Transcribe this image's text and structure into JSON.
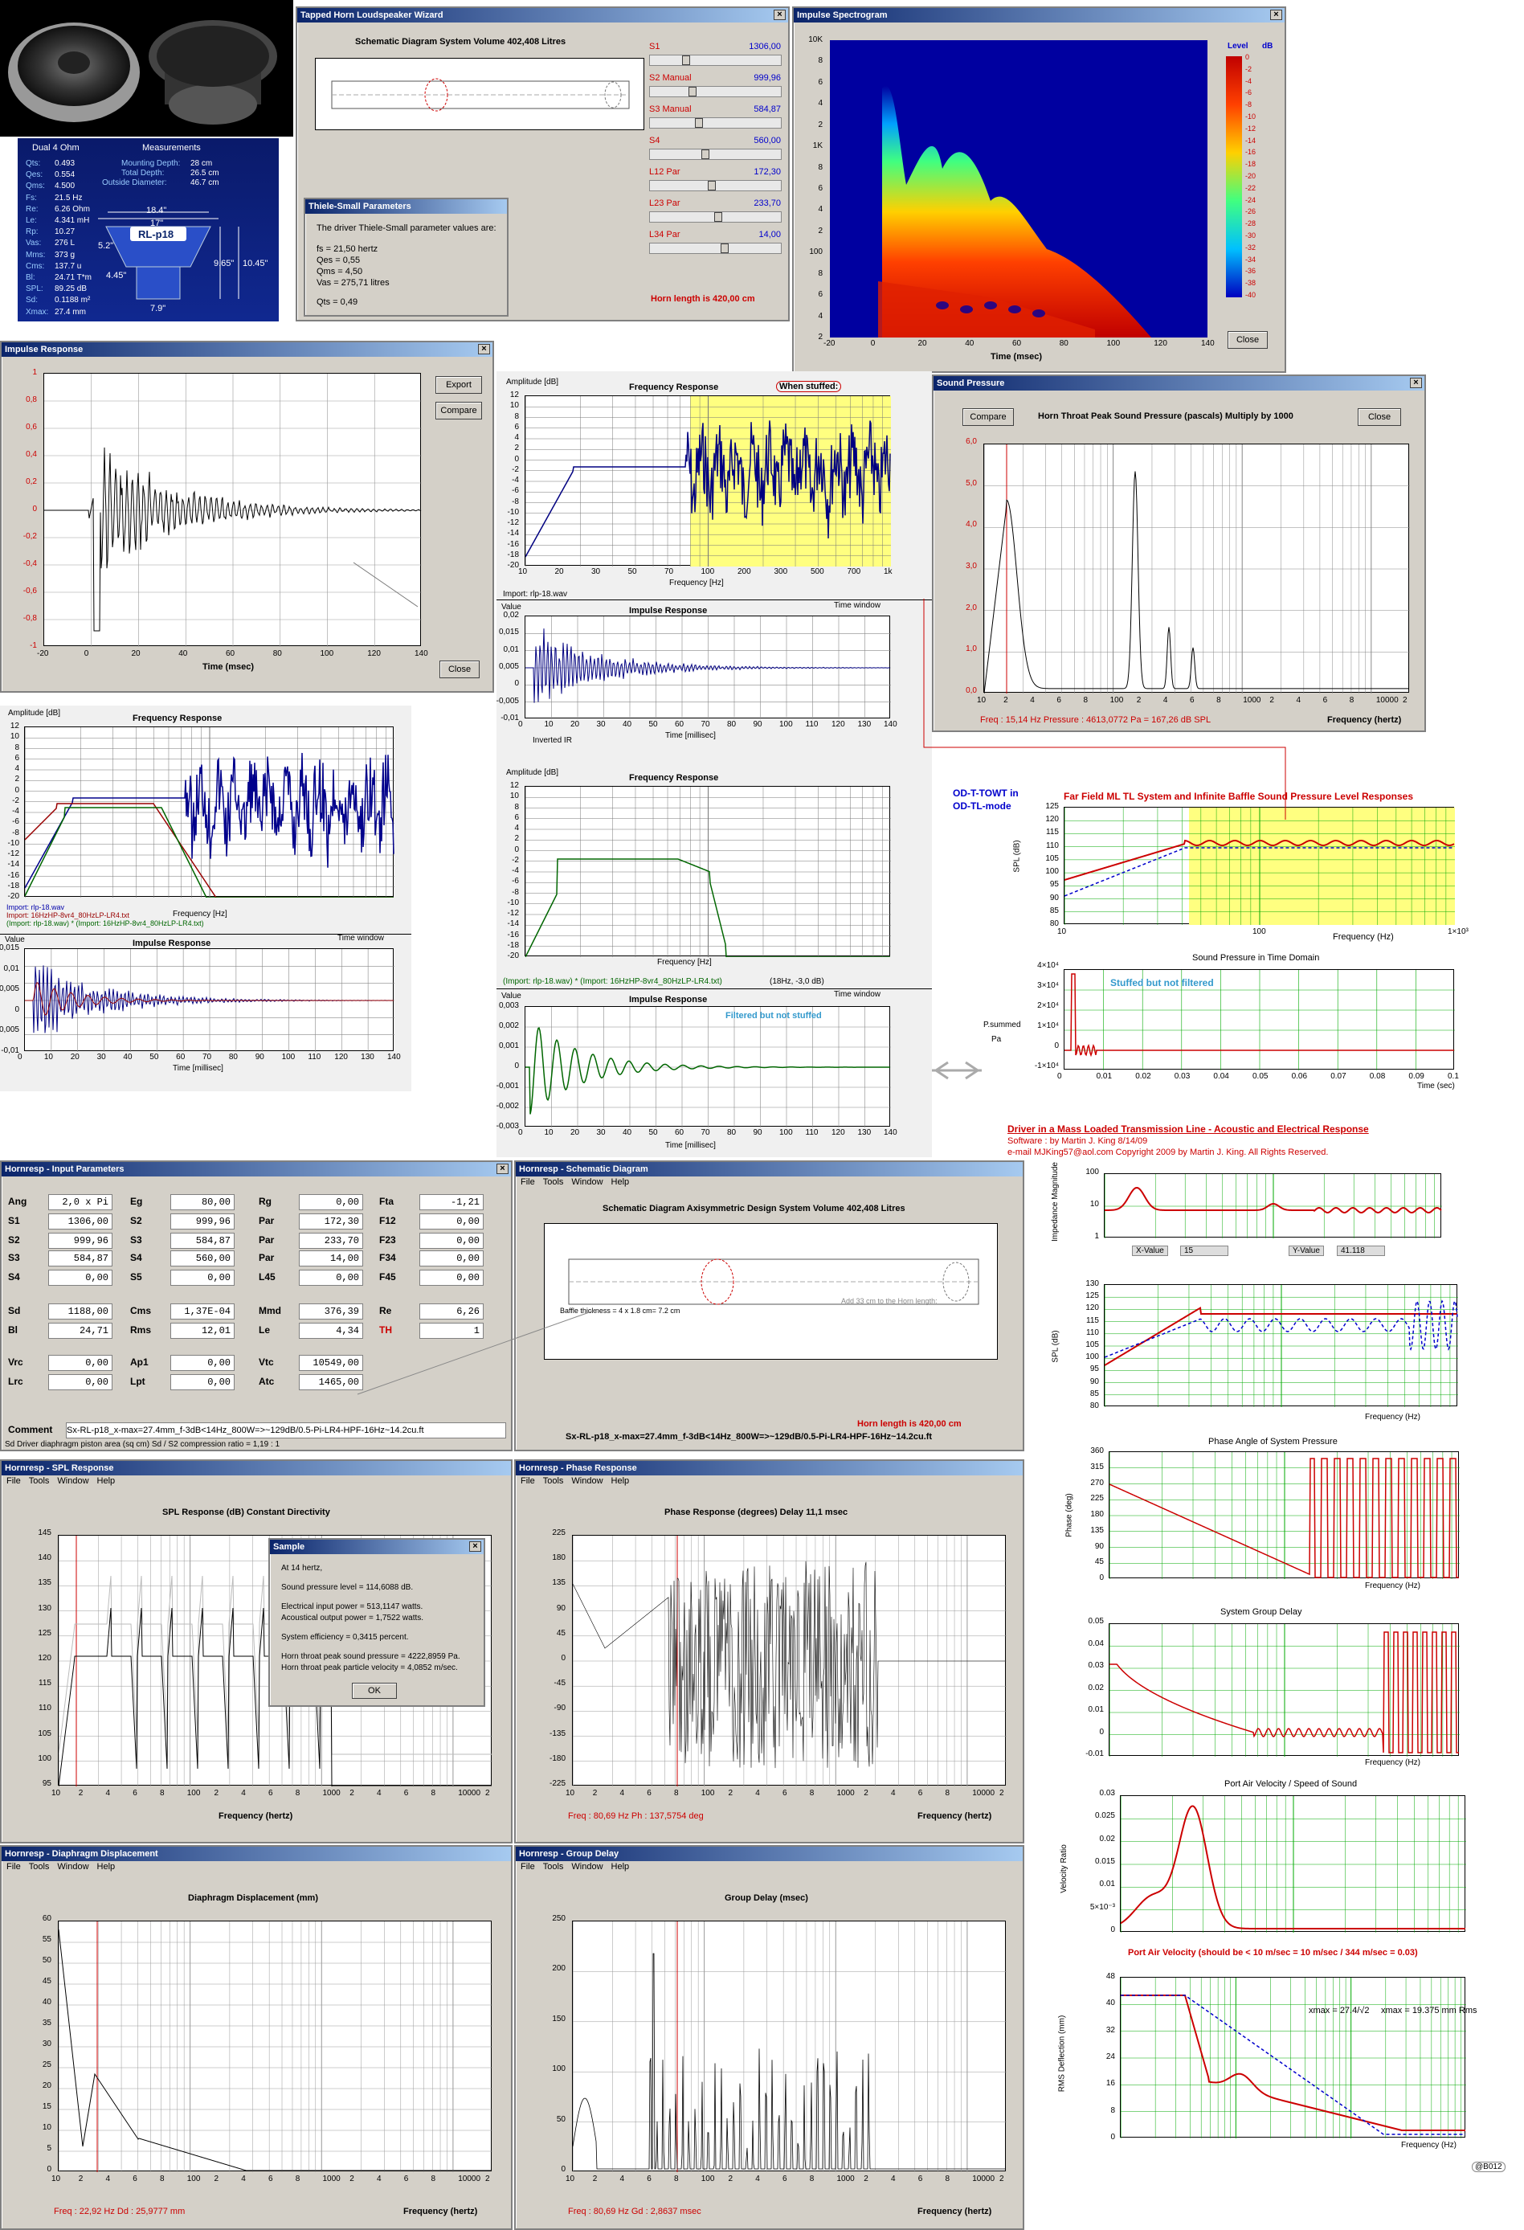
{
  "photo": {
    "panel_labels": {
      "left": "Dual 4 Ohm",
      "right": "Measurements"
    },
    "params": [
      [
        "Qts:",
        "0.493"
      ],
      [
        "Qes:",
        "0.554"
      ],
      [
        "Qms:",
        "4.500"
      ],
      [
        "Fs:",
        "21.5 Hz"
      ],
      [
        "Re:",
        "6.26 Ohm"
      ],
      [
        "Le:",
        "4.341 mH"
      ],
      [
        "Rp:",
        "10.27"
      ],
      [
        "Vas:",
        "276 L"
      ],
      [
        "Mms:",
        "373 g"
      ],
      [
        "Cms:",
        "137.7 u"
      ],
      [
        "Bl:",
        "24.71 T*m"
      ],
      [
        "SPL:",
        "89.25 dB"
      ],
      [
        "Sd:",
        "0.1188 m²"
      ],
      [
        "Xmax:",
        "27.4 mm"
      ]
    ],
    "measures": [
      [
        "Mounting Depth:",
        "28 cm"
      ],
      [
        "Total Depth:",
        "26.5 cm"
      ],
      [
        "Outside Diameter:",
        "46.7 cm"
      ]
    ],
    "dims": [
      "18.4\"",
      "17\"",
      "RL-p18",
      "5.2\"",
      "4.45\"",
      "9.65\"",
      "10.45\"",
      "7.9\""
    ]
  },
  "wizard": {
    "title": "Tapped Horn Loudspeaker Wizard",
    "heading": "Schematic Diagram   System Volume 402,408 Litres",
    "sliders": [
      [
        "S1",
        "1306,00"
      ],
      [
        "S2 Manual",
        "999,96"
      ],
      [
        "S3 Manual",
        "584,87"
      ],
      [
        "S4",
        "560,00"
      ],
      [
        "L12 Par",
        "172,30"
      ],
      [
        "L23 Par",
        "233,70"
      ],
      [
        "L34 Par",
        "14,00"
      ]
    ],
    "horn": "Horn length is 420,00 cm"
  },
  "ts": {
    "title": "Thiele-Small Parameters",
    "intro": "The driver Thiele-Small parameter values are:",
    "lines": [
      "fs = 21,50 hertz",
      "Qes = 0,55",
      "Qms = 4,50",
      "Vas = 275,71 litres",
      "Qts = 0,49"
    ]
  },
  "spectro": {
    "title": "Impulse Spectrogram",
    "legend_title": "Level",
    "legend_unit": "dB",
    "legend_ticks": [
      "0",
      "-2",
      "-4",
      "-6",
      "-8",
      "-10",
      "-12",
      "-14",
      "-16",
      "-18",
      "-20",
      "-22",
      "-24",
      "-26",
      "-28",
      "-30",
      "-32",
      "-34",
      "-36",
      "-38",
      "-40"
    ],
    "yticks": [
      "10K",
      "8",
      "6",
      "4",
      "2",
      "1K",
      "8",
      "6",
      "4",
      "2",
      "100",
      "8",
      "6",
      "4",
      "2"
    ],
    "xticks": [
      "-20",
      "0",
      "20",
      "40",
      "60",
      "80",
      "100",
      "120",
      "140"
    ],
    "xlabel": "Time (msec)",
    "close": "Close"
  },
  "impulse": {
    "title": "Impulse Response",
    "yticks": [
      "1",
      "0,8",
      "0,6",
      "0,4",
      "0,2",
      "0",
      "-0,2",
      "-0,4",
      "-0,6",
      "-0,8",
      "-1"
    ],
    "xticks": [
      "-20",
      "0",
      "20",
      "40",
      "60",
      "80",
      "100",
      "120",
      "140"
    ],
    "xlabel": "Time (msec)",
    "export": "Export",
    "compare": "Compare",
    "close": "Close"
  },
  "center": {
    "fr_title": "Frequency Response",
    "amp": "Amplitude [dB]",
    "stuffed": "When stuffed:",
    "yt": [
      "12",
      "10",
      "8",
      "6",
      "4",
      "2",
      "0",
      "-2",
      "-4",
      "-6",
      "-8",
      "-10",
      "-12",
      "-14",
      "-16",
      "-18",
      "-20"
    ],
    "xt": [
      "10",
      "20",
      "30",
      "50",
      "70",
      "100",
      "200",
      "300",
      "500",
      "700",
      "1k"
    ],
    "xlabel": "Frequency [Hz]",
    "import": "Import: rlp-18.wav",
    "ir_title": "Impulse Response",
    "value": "Value",
    "tw": "Time window",
    "irt": [
      "0,02",
      "0,015",
      "0,01",
      "0,005",
      "0",
      "-0,005",
      "-0,01"
    ],
    "irx": [
      "0",
      "10",
      "20",
      "30",
      "40",
      "50",
      "60",
      "70",
      "80",
      "90",
      "100",
      "110",
      "120",
      "130",
      "140"
    ],
    "irxlabel": "Time [millisec]",
    "inverted": "Inverted IR",
    "fr2_title": "Frequency Response",
    "legend2": "(Import: rlp-18.wav) * (Import: 16HzHP-8vr4_80HzLP-LR4.txt)",
    "legend2b": "(18Hz, -3,0 dB)",
    "ir2_title": "Impulse Response",
    "ir2t": [
      "0,003",
      "0,002",
      "0,001",
      "0",
      "-0,001",
      "-0,002",
      "-0,003"
    ],
    "filt": "Filtered but not stuffed"
  },
  "left2": {
    "amp": "Amplitude [dB]",
    "title": "Frequency Response",
    "yt": [
      "12",
      "10",
      "8",
      "6",
      "4",
      "2",
      "0",
      "-2",
      "-4",
      "-6",
      "-8",
      "-10",
      "-12",
      "-14",
      "-16",
      "-18",
      "-20"
    ],
    "xt": [
      "10",
      "20",
      "30",
      "50",
      "70",
      "100",
      "200",
      "300",
      "500",
      "700",
      "1k"
    ],
    "legend": [
      "Import: rlp-18.wav",
      "Import: 16HzHP-8vr4_80HzLP-LR4.txt",
      "(Import: rlp-18.wav) * (Import: 16HzHP-8vr4_80HzLP-LR4.txt)"
    ],
    "xlabel": "Frequency [Hz]",
    "ir_title": "Impulse Response",
    "value": "Value",
    "tw": "Time window",
    "irt": [
      "0,015",
      "0,01",
      "0,005",
      "0",
      "-0,005",
      "-0,01"
    ],
    "irx": [
      "0",
      "10",
      "20",
      "30",
      "40",
      "50",
      "60",
      "70",
      "80",
      "90",
      "100",
      "110",
      "120",
      "130",
      "140"
    ],
    "irxlabel": "Time [millisec]"
  },
  "sp": {
    "title": "Sound Pressure",
    "heading": "Horn Throat Peak Sound Pressure (pascals)   Multiply by 1000",
    "compare": "Compare",
    "close": "Close",
    "yt": [
      "6,0",
      "5,0",
      "4,0",
      "3,0",
      "2,0",
      "1,0",
      "0,0"
    ],
    "xt": [
      "10",
      "2",
      "4",
      "6",
      "8",
      "100",
      "2",
      "4",
      "6",
      "8",
      "1000",
      "2",
      "4",
      "6",
      "8",
      "10000",
      "2"
    ],
    "xlabel": "Frequency (hertz)",
    "status": "Freq : 15,14 Hz     Pressure : 4613,0772 Pa     = 167,26 dB SPL"
  },
  "mk": {
    "odt": "OD-T-TOWT in",
    "odtl": "OD-TL-mode",
    "ff_title": "Far Field ML TL System and Infinite Baffle Sound Pressure Level Responses",
    "spl": "SPL (dB)",
    "ffyt": [
      "125",
      "120",
      "115",
      "110",
      "105",
      "100",
      "95",
      "90",
      "85",
      "80"
    ],
    "ffxt": [
      "10",
      "100",
      "1×10³"
    ],
    "ffxlabel": "Frequency (Hz)",
    "sp_title": "Sound Pressure in Time Domain",
    "spyt": [
      "4×10⁴",
      "3×10⁴",
      "2×10⁴",
      "1×10⁴",
      "0",
      "-1×10⁴"
    ],
    "spxt": [
      "0",
      "0.01",
      "0.02",
      "0.03",
      "0.04",
      "0.05",
      "0.06",
      "0.07",
      "0.08",
      "0.09",
      "0.1"
    ],
    "spxlabel": "Time (sec)",
    "stuffed": "Stuffed but not filtered",
    "pa": "Pa",
    "psum": "P.summed",
    "credit1": "Driver in a Mass Loaded Transmission Line - Acoustic and Electrical Response",
    "credit2": "Software :       by         Martin J. King                    8/14/09",
    "credit3": "e-mail  MJKing57@aol.com    Copyright 2009 by Martin J. King. All Rights Reserved.",
    "imp_label": "Impedance Magnitude",
    "imyt": [
      "100",
      "10",
      "1"
    ],
    "imxt": [
      "10",
      "100"
    ],
    "xval_l": "X-Value",
    "xval": "15",
    "yval_l": "Y-Value",
    "yval": "41.118",
    "spl2yt": [
      "130",
      "125",
      "120",
      "115",
      "110",
      "105",
      "100",
      "95",
      "90",
      "85",
      "80"
    ],
    "spl2xt": [
      "10",
      "100",
      "1×10³"
    ],
    "ph_title": "Phase Angle of System Pressure",
    "phyt": [
      "360",
      "315",
      "270",
      "225",
      "180",
      "135",
      "90",
      "45",
      "0"
    ],
    "ph_label": "Phase (deg)",
    "gd_title": "System Group Delay",
    "gdyt": [
      "0.05",
      "0.04",
      "0.03",
      "0.02",
      "0.01",
      "0",
      "-0.01"
    ],
    "pv_title": "Port Air Velocity / Speed of Sound",
    "pvyt": [
      "0.03",
      "0.025",
      "0.02",
      "0.015",
      "0.01",
      "5×10⁻³",
      "0"
    ],
    "pv_label": "Velocity Ratio",
    "pv_note": "Port Air Velocity (should be < 10 m/sec = 10 m/sec / 344 m/sec = 0.03)",
    "rms_label": "RMS Deflection (mm)",
    "rmsyt": [
      "48",
      "40",
      "32",
      "24",
      "16",
      "8",
      "0"
    ],
    "xmax1": "xmax = 27.4/√2",
    "xmax2": "xmax = 19.375  mm Rms",
    "fxlabel": "Frequency (Hz)",
    "xt3": [
      "1",
      "10",
      "100",
      "1×10³"
    ]
  },
  "hinp": {
    "title": "Hornresp - Input Parameters",
    "rows": [
      [
        [
          "Ang",
          "2,0 x Pi"
        ],
        [
          "Eg",
          "80,00"
        ],
        [
          "Rg",
          "0,00"
        ],
        [
          "Fta",
          "-1,21"
        ]
      ],
      [
        [
          "S1",
          "1306,00"
        ],
        [
          "S2",
          "999,96"
        ],
        [
          "Par",
          "172,30"
        ],
        [
          "F12",
          "0,00"
        ]
      ],
      [
        [
          "S2",
          "999,96"
        ],
        [
          "S3",
          "584,87"
        ],
        [
          "Par",
          "233,70"
        ],
        [
          "F23",
          "0,00"
        ]
      ],
      [
        [
          "S3",
          "584,87"
        ],
        [
          "S4",
          "560,00"
        ],
        [
          "Par",
          "14,00"
        ],
        [
          "F34",
          "0,00"
        ]
      ],
      [
        [
          "S4",
          "0,00"
        ],
        [
          "S5",
          "0,00"
        ],
        [
          "L45",
          "0,00"
        ],
        [
          "F45",
          "0,00"
        ]
      ],
      [
        [
          "Sd",
          "1188,00"
        ],
        [
          "Cms",
          "1,37E-04"
        ],
        [
          "Mmd",
          "376,39"
        ],
        [
          "Re",
          "6,26"
        ]
      ],
      [
        [
          "Bl",
          "24,71"
        ],
        [
          "Rms",
          "12,01"
        ],
        [
          "Le",
          "4,34"
        ],
        [
          "TH",
          "1"
        ]
      ],
      [
        [
          "Vrc",
          "0,00"
        ],
        [
          "Ap1",
          "0,00"
        ],
        [
          "Vtc",
          "10549,00"
        ],
        [
          "",
          ""
        ]
      ],
      [
        [
          "Lrc",
          "0,00"
        ],
        [
          "Lpt",
          "0,00"
        ],
        [
          "Atc",
          "1465,00"
        ],
        [
          "",
          ""
        ]
      ]
    ],
    "comment_l": "Comment",
    "comment": "Sx-RL-p18_x-max=27.4mm_f-3dB<14Hz_800W=>~129dB/0.5-Pi-LR4-HPF-16Hz~14.2cu.ft",
    "status": "Sd   Driver diaphragm piston area  (sq cm)    Sd / S2 compression ratio = 1,19 : 1"
  },
  "hsch": {
    "title": "Hornresp - Schematic Diagram",
    "menu": [
      "File",
      "Tools",
      "Window",
      "Help"
    ],
    "heading": "Schematic Diagram   Axisymmetric Design   System Volume 402,408 Litres",
    "baffle": "Baffle thickness = 4 x 1.8 cm= 7.2 cm",
    "add": "Add 33 cm to the Horn length:",
    "horn": "Horn length is 420,00 cm",
    "comment": "Sx-RL-p18_x-max=27.4mm_f-3dB<14Hz_800W=>~129dB/0.5-Pi-LR4-HPF-16Hz~14.2cu.ft"
  },
  "hspl": {
    "title": "Hornresp - SPL Response",
    "menu": [
      "File",
      "Tools",
      "Window",
      "Help"
    ],
    "heading": "SPL Response (dB)    Constant Directivity",
    "yt": [
      "145",
      "140",
      "135",
      "130",
      "125",
      "120",
      "115",
      "110",
      "105",
      "100",
      "95"
    ],
    "xt": [
      "10",
      "2",
      "4",
      "6",
      "8",
      "100",
      "2",
      "4",
      "6",
      "8",
      "1000",
      "2",
      "4",
      "6",
      "8",
      "10000",
      "2"
    ],
    "xlabel": "Frequency (hertz)",
    "dlg_title": "Sample",
    "dlg": [
      "At 14 hertz,",
      "Sound pressure level = 114,6088 dB.",
      "Electrical input power = 513,1147 watts.",
      "Acoustical output power = 1,7522 watts.",
      "System efficiency = 0,3415 percent.",
      "Horn throat peak sound pressure = 4222,8959 Pa.",
      "Horn throat peak particle velocity = 4,0852 m/sec."
    ],
    "ok": "OK"
  },
  "hph": {
    "title": "Hornresp - Phase Response",
    "menu": [
      "File",
      "Tools",
      "Window",
      "Help"
    ],
    "heading": "Phase Response (degrees)   Delay 11,1 msec",
    "yt": [
      "225",
      "180",
      "135",
      "90",
      "45",
      "0",
      "-45",
      "-90",
      "-135",
      "-180",
      "-225"
    ],
    "xt": [
      "10",
      "2",
      "4",
      "6",
      "8",
      "100",
      "2",
      "4",
      "6",
      "8",
      "1000",
      "2",
      "4",
      "6",
      "8",
      "10000",
      "2"
    ],
    "xlabel": "Frequency (hertz)",
    "status": "Freq : 80,69 Hz    Ph : 137,5754 deg"
  },
  "hdd": {
    "title": "Hornresp - Diaphragm Displacement",
    "menu": [
      "File",
      "Tools",
      "Window",
      "Help"
    ],
    "heading": "Diaphragm Displacement (mm)",
    "yt": [
      "60",
      "55",
      "50",
      "45",
      "40",
      "35",
      "30",
      "25",
      "20",
      "15",
      "10",
      "5",
      "0"
    ],
    "xt": [
      "10",
      "2",
      "4",
      "6",
      "8",
      "100",
      "2",
      "4",
      "6",
      "8",
      "1000",
      "2",
      "4",
      "6",
      "8",
      "10000",
      "2"
    ],
    "xlabel": "Frequency (hertz)",
    "status": "Freq : 22,92 Hz    Dd : 25,9777 mm"
  },
  "hgd": {
    "title": "Hornresp - Group Delay",
    "menu": [
      "File",
      "Tools",
      "Window",
      "Help"
    ],
    "heading": "Group Delay (msec)",
    "yt": [
      "250",
      "200",
      "150",
      "100",
      "50",
      "0"
    ],
    "xt": [
      "10",
      "2",
      "4",
      "6",
      "8",
      "100",
      "2",
      "4",
      "6",
      "8",
      "1000",
      "2",
      "4",
      "6",
      "8",
      "10000",
      "2"
    ],
    "xlabel": "Frequency (hertz)",
    "status": "Freq : 80,69 Hz    Gd : 2,8637 msec"
  },
  "stamp": "@B012"
}
